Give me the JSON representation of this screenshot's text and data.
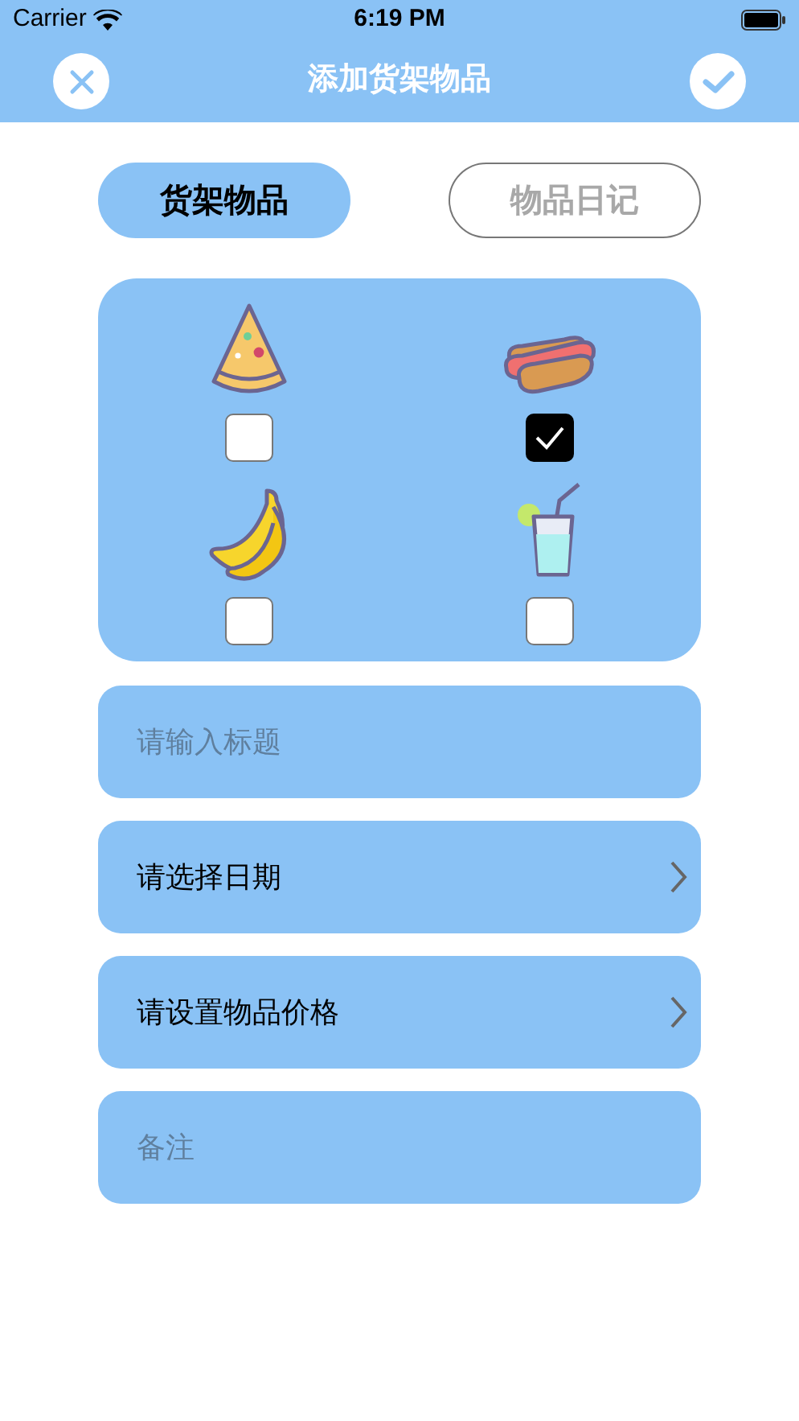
{
  "status_bar": {
    "carrier": "Carrier",
    "time": "6:19 PM"
  },
  "nav": {
    "title": "添加货架物品"
  },
  "tabs": [
    {
      "label": "货架物品",
      "selected": true
    },
    {
      "label": "物品日记",
      "selected": false
    }
  ],
  "items": [
    {
      "kind": "pizza",
      "checked": false
    },
    {
      "kind": "hotdog",
      "checked": true
    },
    {
      "kind": "banana",
      "checked": false
    },
    {
      "kind": "drink",
      "checked": false
    }
  ],
  "fields": [
    {
      "kind": "input",
      "placeholder": "请输入标题"
    },
    {
      "kind": "picker",
      "label": "请选择日期"
    },
    {
      "kind": "picker",
      "label": "请设置物品价格"
    },
    {
      "kind": "input",
      "placeholder": "备注"
    }
  ]
}
